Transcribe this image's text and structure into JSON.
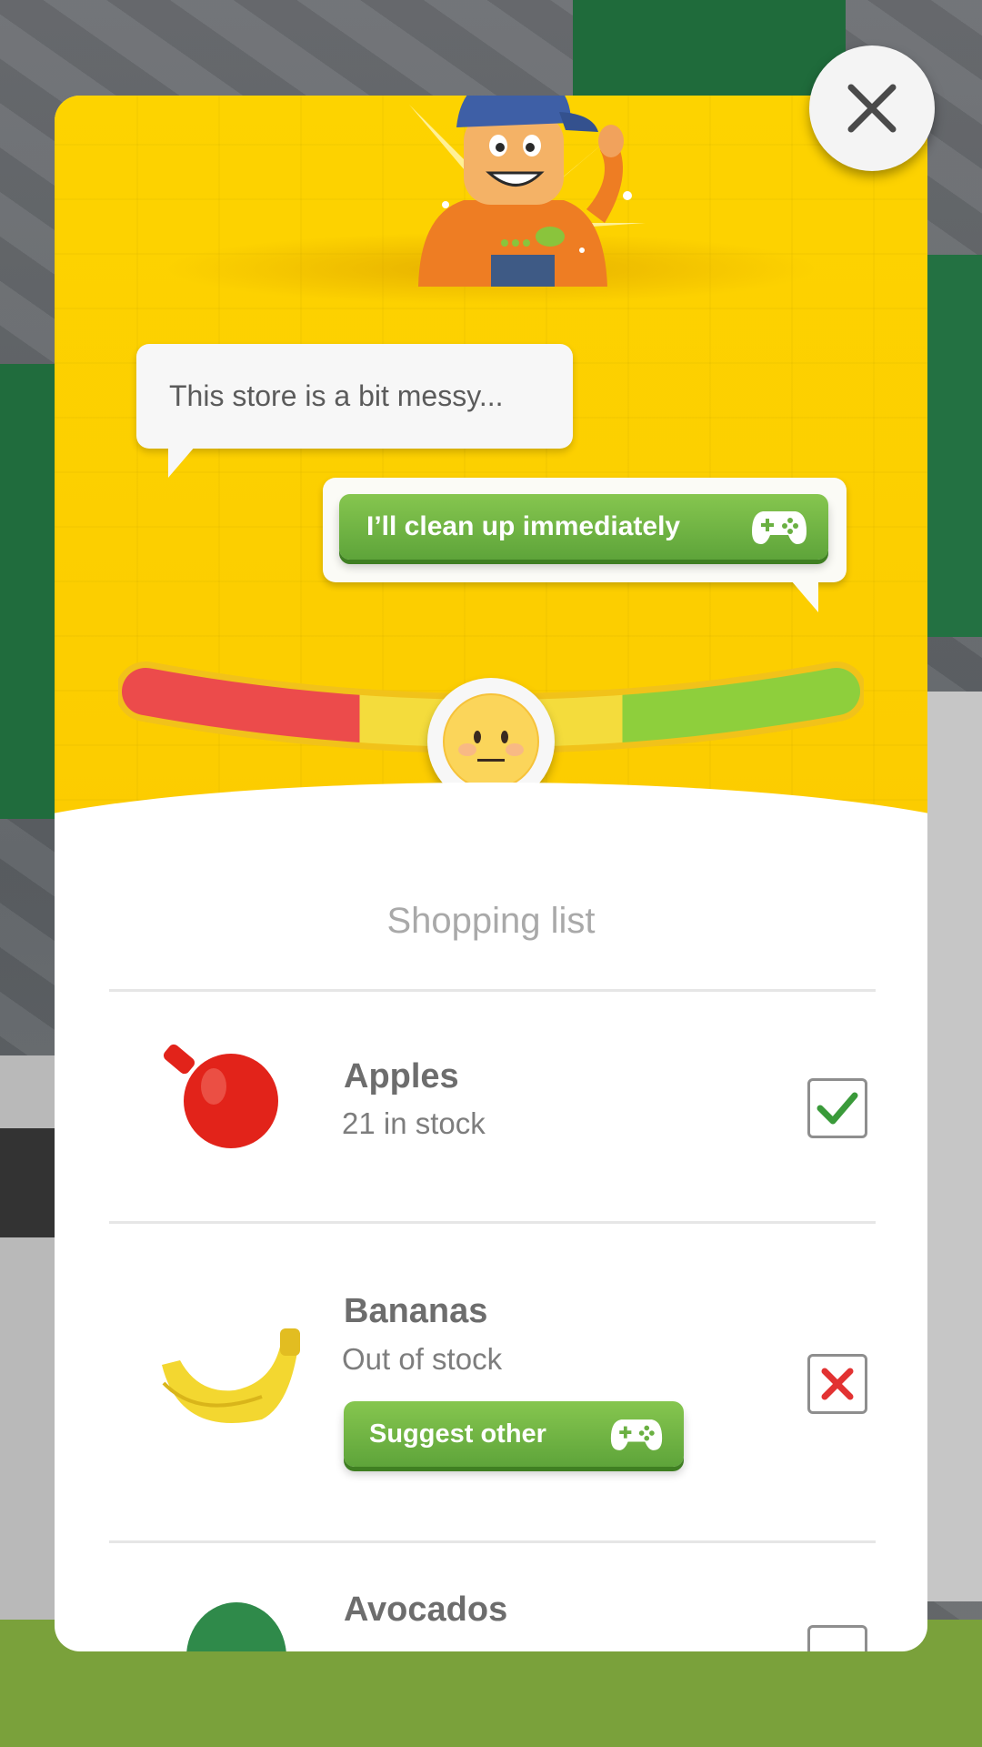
{
  "dialog": {
    "speech": "This store is a bit messy...",
    "reply_button": "I’ll clean up immediately",
    "mood_level": 0.5
  },
  "shopping": {
    "title": "Shopping list",
    "items": [
      {
        "name": "Apples",
        "status": "21 in stock",
        "checked": "yes",
        "icon": "apple-icon"
      },
      {
        "name": "Bananas",
        "status": "Out of stock",
        "checked": "no",
        "icon": "banana-icon",
        "action": "Suggest other"
      },
      {
        "name": "Avocados",
        "status": "",
        "checked": "",
        "icon": "avocado-icon"
      }
    ]
  },
  "colors": {
    "header_yellow": "#fdd000",
    "button_green": "#6ab042",
    "meter_red": "#ec4b4b",
    "meter_yellow": "#f4dc3c",
    "meter_green": "#8ecf3c",
    "check_green": "#3a9a3a",
    "cross_red": "#e23232"
  }
}
